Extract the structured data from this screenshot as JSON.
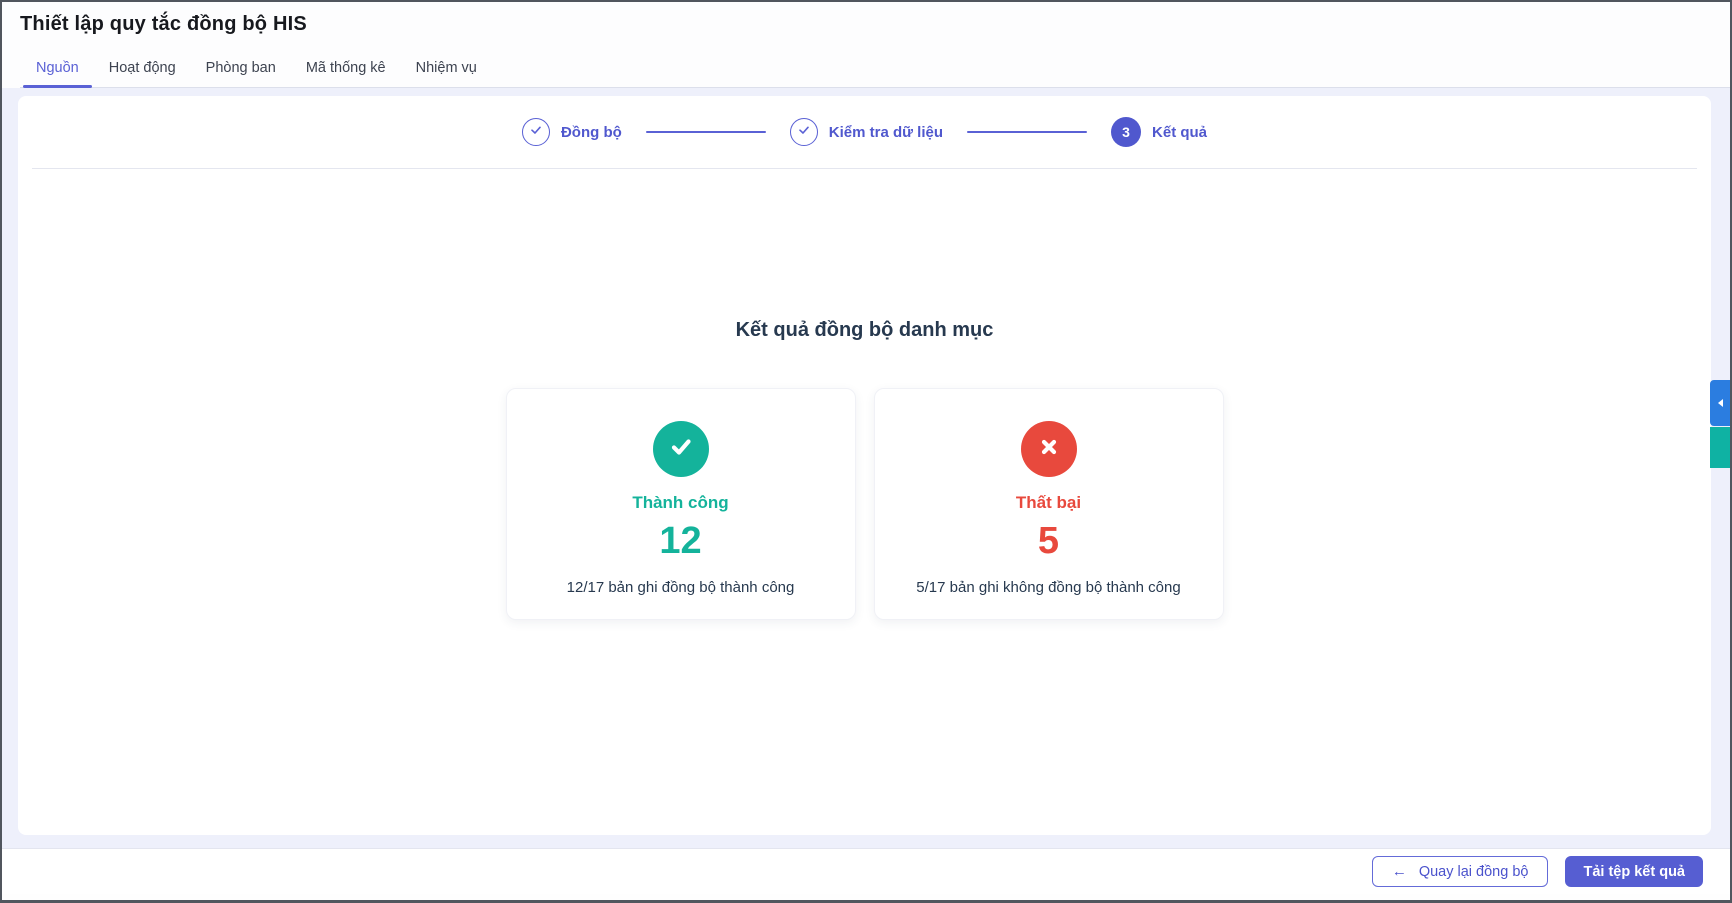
{
  "page": {
    "title": "Thiết lập quy tắc đồng bộ HIS"
  },
  "tabs": [
    {
      "label": "Nguồn",
      "active": true
    },
    {
      "label": "Hoạt động",
      "active": false
    },
    {
      "label": "Phòng ban",
      "active": false
    },
    {
      "label": "Mã thống kê",
      "active": false
    },
    {
      "label": "Nhiệm vụ",
      "active": false
    }
  ],
  "stepper": {
    "steps": [
      {
        "label": "Đồng bộ",
        "state": "completed"
      },
      {
        "label": "Kiểm tra dữ liệu",
        "state": "completed"
      },
      {
        "label": "Kết quả",
        "state": "active",
        "number": "3"
      }
    ]
  },
  "results": {
    "title": "Kết quả đồng bộ danh mục",
    "cards": [
      {
        "type": "success",
        "icon": "check-icon",
        "label": "Thành công",
        "count": "12",
        "description": "12/17 bản ghi đồng bộ thành công",
        "color": "#14b39b"
      },
      {
        "type": "failure",
        "icon": "x-icon",
        "label": "Thất bại",
        "count": "5",
        "description": "5/17 bản ghi không đồng bộ thành công",
        "color": "#e8493d"
      }
    ]
  },
  "footer": {
    "back_arrow": "←",
    "back_button": "Quay lại đồng bộ",
    "download_button": "Tải tệp kết quả"
  },
  "colors": {
    "accent_purple": "#5a61d5",
    "success_green": "#14b39b",
    "danger_red": "#e8493d",
    "text_dark": "#27394f",
    "content_background": "#eef0fb",
    "edge_tab_blue": "#2b7de0",
    "edge_tab_teal": "#0fb2a3"
  }
}
